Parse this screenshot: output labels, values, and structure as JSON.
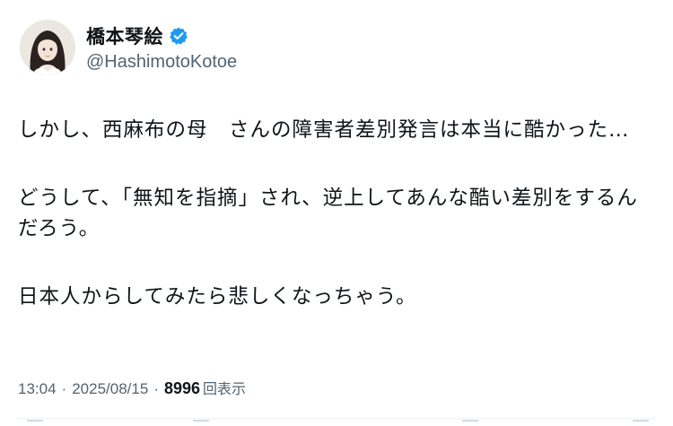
{
  "author": {
    "display_name": "橋本琴絵",
    "handle": "@HashimotoKotoe",
    "verified_icon": "verified-badge-icon",
    "accent_color": "#1d9bf0"
  },
  "tweet": {
    "lines": [
      "しかし、西麻布の母　さんの障害者差別発言は本当に酷かった…",
      "どうして、「無知を指摘」され、逆上してあんな酷い差別をするんだろう。",
      "日本人からしてみたら悲しくなっちゃう。"
    ]
  },
  "meta": {
    "time": "13:04",
    "date": "2025/08/15",
    "separator": "·",
    "views_count": "8996",
    "views_label": "回表示"
  }
}
